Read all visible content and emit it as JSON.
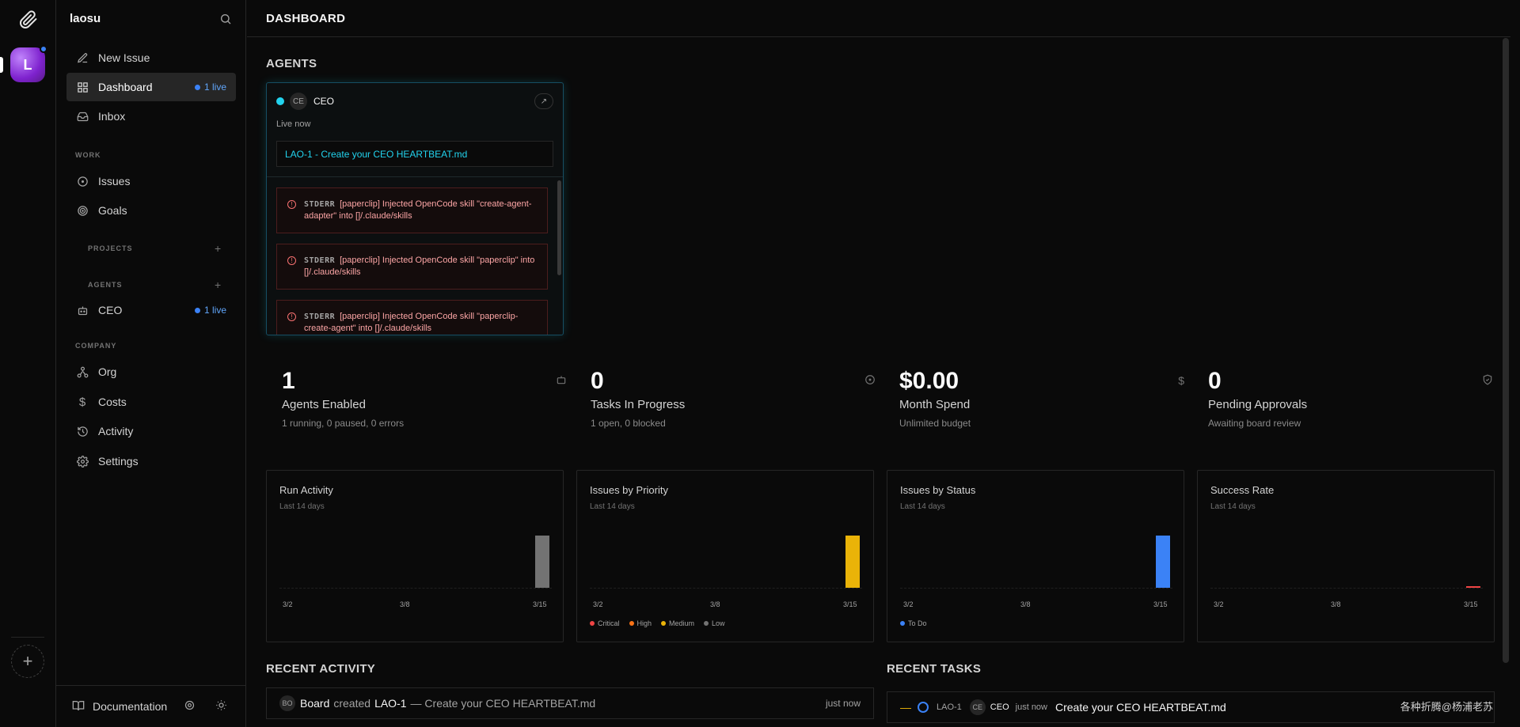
{
  "sidebar": {
    "company_name": "laosu",
    "org_avatar_initial": "L",
    "items": {
      "new_issue": "New Issue",
      "dashboard": "Dashboard",
      "dashboard_live": "1 live",
      "inbox": "Inbox",
      "issues": "Issues",
      "goals": "Goals",
      "ceo": "CEO",
      "ceo_live": "1 live",
      "org": "Org",
      "costs": "Costs",
      "activity": "Activity",
      "settings": "Settings"
    },
    "sections": {
      "work": "WORK",
      "projects": "PROJECTS",
      "agents": "AGENTS",
      "company": "COMPANY"
    },
    "footer": {
      "documentation": "Documentation"
    }
  },
  "header": {
    "title": "DASHBOARD"
  },
  "agents_section": {
    "title": "AGENTS",
    "card": {
      "avatar": "CE",
      "name": "CEO",
      "status": "Live now",
      "issue_link": "LAO-1 - Create your CEO HEARTBEAT.md",
      "logs": [
        {
          "tag": "STDERR",
          "text": "[paperclip] Injected OpenCode skill \"create-agent-adapter\" into []/.claude/skills"
        },
        {
          "tag": "STDERR",
          "text": "[paperclip] Injected OpenCode skill \"paperclip\" into []/.claude/skills"
        },
        {
          "tag": "STDERR",
          "text": "[paperclip] Injected OpenCode skill \"paperclip-create-agent\" into []/.claude/skills"
        }
      ]
    }
  },
  "stats": [
    {
      "value": "1",
      "label": "Agents Enabled",
      "sub": "1 running, 0 paused, 0 errors",
      "icon": "bot-icon"
    },
    {
      "value": "0",
      "label": "Tasks In Progress",
      "sub": "1 open, 0 blocked",
      "icon": "circle-dot-icon"
    },
    {
      "value": "$0.00",
      "label": "Month Spend",
      "sub": "Unlimited budget",
      "icon": "dollar-icon"
    },
    {
      "value": "0",
      "label": "Pending Approvals",
      "sub": "Awaiting board review",
      "icon": "shield-check-icon"
    }
  ],
  "charts": [
    {
      "title": "Run Activity",
      "subtitle": "Last 14 days",
      "ticks": [
        "3/2",
        "3/8",
        "3/15"
      ]
    },
    {
      "title": "Issues by Priority",
      "subtitle": "Last 14 days",
      "ticks": [
        "3/2",
        "3/8",
        "3/15"
      ],
      "legend": [
        "Critical",
        "High",
        "Medium",
        "Low"
      ]
    },
    {
      "title": "Issues by Status",
      "subtitle": "Last 14 days",
      "ticks": [
        "3/2",
        "3/8",
        "3/15"
      ],
      "legend": [
        "To Do"
      ]
    },
    {
      "title": "Success Rate",
      "subtitle": "Last 14 days",
      "ticks": [
        "3/2",
        "3/8",
        "3/15"
      ]
    }
  ],
  "chart_data": [
    {
      "type": "bar",
      "title": "Run Activity",
      "categories": [
        "3/2",
        "3/3",
        "3/4",
        "3/5",
        "3/6",
        "3/7",
        "3/8",
        "3/9",
        "3/10",
        "3/11",
        "3/12",
        "3/13",
        "3/14",
        "3/15"
      ],
      "values": [
        0,
        0,
        0,
        0,
        0,
        0,
        0,
        0,
        0,
        0,
        0,
        0,
        0,
        1
      ],
      "color": "#737373"
    },
    {
      "type": "bar",
      "title": "Issues by Priority",
      "categories": [
        "3/2",
        "3/3",
        "3/4",
        "3/5",
        "3/6",
        "3/7",
        "3/8",
        "3/9",
        "3/10",
        "3/11",
        "3/12",
        "3/13",
        "3/14",
        "3/15"
      ],
      "series": [
        {
          "name": "Medium",
          "values": [
            0,
            0,
            0,
            0,
            0,
            0,
            0,
            0,
            0,
            0,
            0,
            0,
            0,
            1
          ]
        }
      ],
      "legend": [
        "Critical",
        "High",
        "Medium",
        "Low"
      ],
      "colors": {
        "Critical": "#ef4444",
        "High": "#f97316",
        "Medium": "#eab308",
        "Low": "#737373"
      }
    },
    {
      "type": "bar",
      "title": "Issues by Status",
      "categories": [
        "3/2",
        "3/3",
        "3/4",
        "3/5",
        "3/6",
        "3/7",
        "3/8",
        "3/9",
        "3/10",
        "3/11",
        "3/12",
        "3/13",
        "3/14",
        "3/15"
      ],
      "series": [
        {
          "name": "To Do",
          "values": [
            0,
            0,
            0,
            0,
            0,
            0,
            0,
            0,
            0,
            0,
            0,
            0,
            0,
            1
          ]
        }
      ],
      "colors": {
        "To Do": "#3b82f6"
      }
    },
    {
      "type": "bar",
      "title": "Success Rate",
      "categories": [
        "3/2",
        "3/3",
        "3/4",
        "3/5",
        "3/6",
        "3/7",
        "3/8",
        "3/9",
        "3/10",
        "3/11",
        "3/12",
        "3/13",
        "3/14",
        "3/15"
      ],
      "values": [
        0,
        0,
        0,
        0,
        0,
        0,
        0,
        0,
        0,
        0,
        0,
        0,
        0,
        0
      ],
      "color": "#ef4444"
    }
  ],
  "recent_activity": {
    "title": "RECENT ACTIVITY",
    "rows": [
      {
        "avatar": "BO",
        "actor": "Board",
        "verb": "created",
        "target": "LAO-1",
        "detail": "— Create your CEO HEARTBEAT.md",
        "time": "just now"
      }
    ]
  },
  "recent_tasks": {
    "title": "RECENT TASKS",
    "rows": [
      {
        "id": "LAO-1",
        "avatar": "CE",
        "agent": "CEO",
        "time": "just now",
        "title": "Create your CEO HEARTBEAT.md"
      }
    ]
  },
  "watermark": "各种折腾@杨浦老苏"
}
